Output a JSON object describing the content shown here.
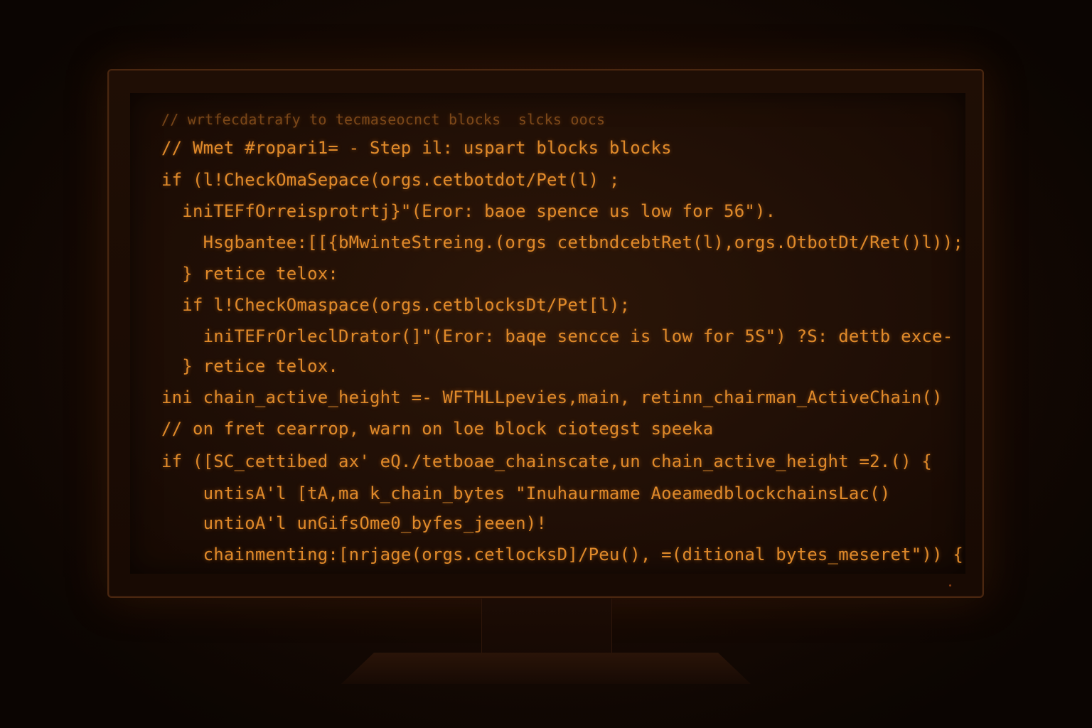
{
  "code_lines": [
    "// wrtfecdatrafy to tecmaseocnct blocks  slcks oocs",
    "// Wmet #ropari1= - Step il: uspart blocks blocks",
    "if (l!CheckOmaSepace(orgs.cetbotdot/Pet(l) ;",
    "  iniTEFfOrreisprotrtj}\"(Eror: baoe spence us low for 56\").",
    "    Hsgbantee:[[{bMwinteStreing.(orgs cetbndcebtRet(l),orgs.OtbotDt/Ret()l));",
    "  } retice telox:",
    "  if l!CheckOmaspace(orgs.cetblocksDt/Pet[l);",
    "    iniTEFrOrleclDrator(]\"(Eror: baqe sencce is low for 5S\") ?S: dettb exce-",
    "  } retice telox.",
    "ini chain_active_height =- WFTHLLpevies,main, retinn_chairman_ActiveChain()",
    "// on fret cearrop, warn on loe block ciotegst speeka",
    "if ([SC_cettibed ax' eQ./tetboae_chainscate,un chain_active_height =2.() {",
    "    untisA'l [tA,ma k_chain_bytes \"Inuhaurmame AoeamedblockchainsLac()",
    "    untioA'l unGifsOme0_byfes_jeeen)!",
    "    chainmenting:[nrjage(orgs.cetlocksD]/Peu(), =(ditional bytes_meseret\")) {"
  ]
}
